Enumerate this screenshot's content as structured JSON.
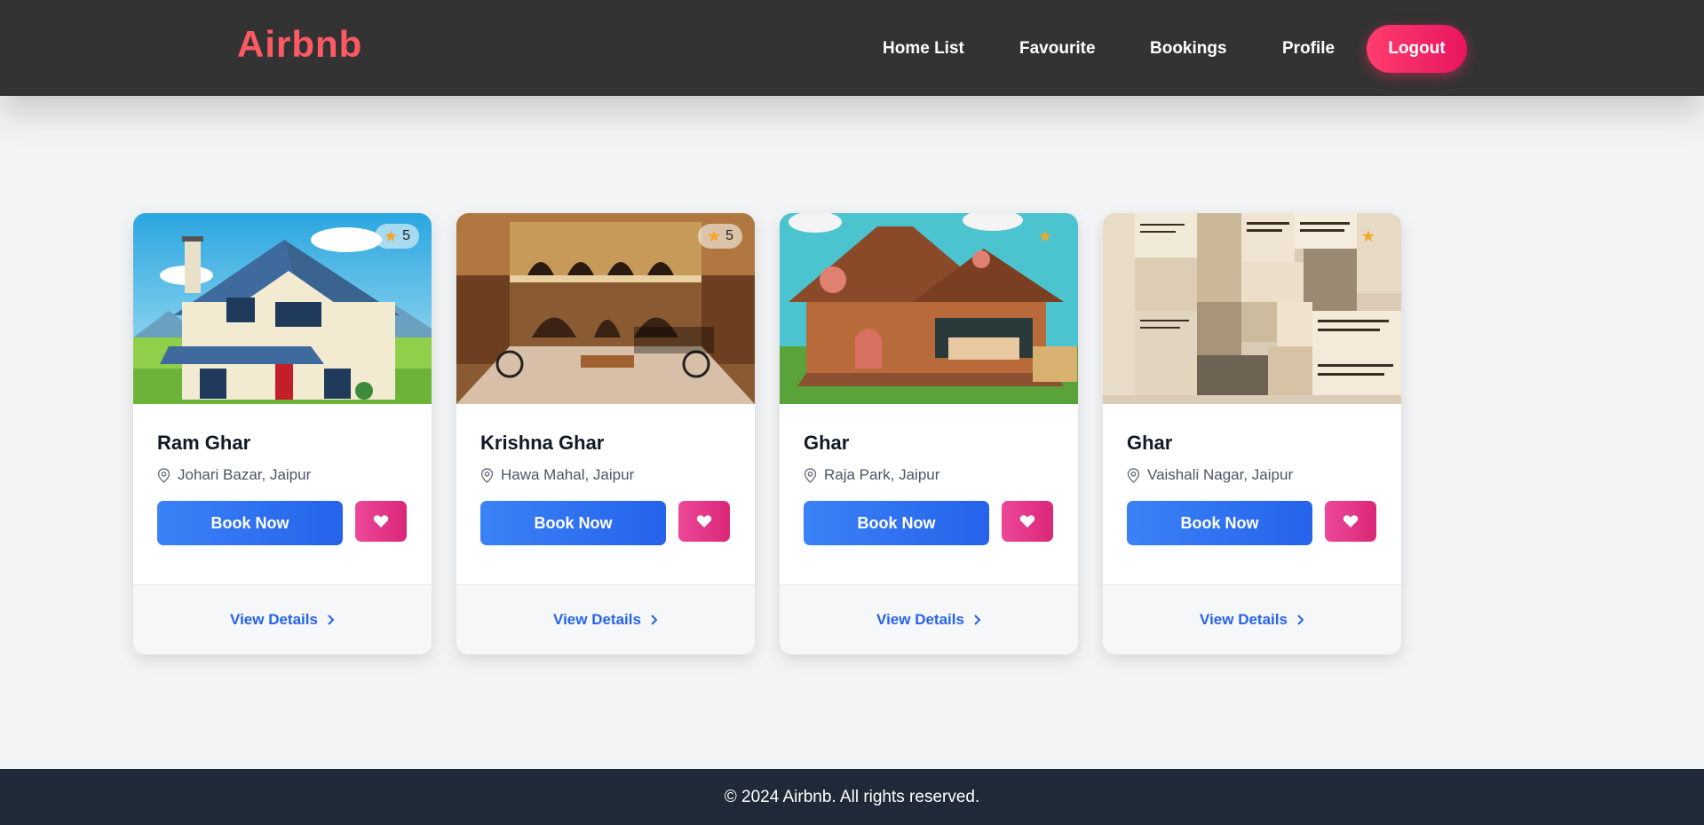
{
  "brand": "Airbnb",
  "nav": {
    "links": [
      "Home List",
      "Favourite",
      "Bookings",
      "Profile"
    ],
    "logout": "Logout"
  },
  "colors": {
    "brand": "#ff5a64",
    "navbar_bg": "#333333",
    "primary_button": "#2563eb",
    "favourite_button": "#db2777",
    "footer_bg": "#1f2937"
  },
  "homes": [
    {
      "name": "Ram Ghar",
      "location": "Johari Bazar, Jaipur",
      "rating": "5",
      "image": "house-illustration"
    },
    {
      "name": "Krishna Ghar",
      "location": "Hawa Mahal, Jaipur",
      "rating": "5",
      "image": "palace-courtyard-photo"
    },
    {
      "name": "Ghar",
      "location": "Raja Park, Jaipur",
      "rating": "",
      "image": "cottage-illustration"
    },
    {
      "name": "Ghar",
      "location": "Vaishali Nagar, Jaipur",
      "rating": "",
      "image": "quotes-collage"
    }
  ],
  "card_actions": {
    "book": "Book Now",
    "details": "View Details"
  },
  "icons": {
    "location": "map-pin-icon",
    "favourite": "heart-icon",
    "details": "chevron-right-icon",
    "rating": "star-icon"
  },
  "footer": {
    "text": "© 2024 Airbnb. All rights reserved."
  }
}
